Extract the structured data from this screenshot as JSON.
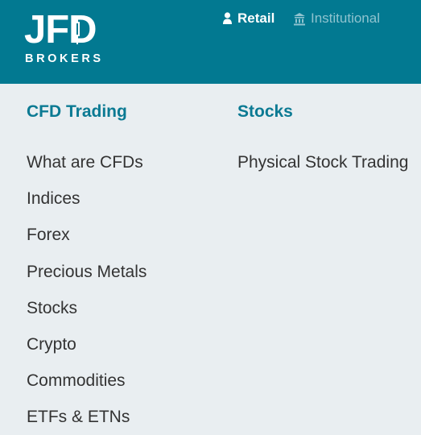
{
  "brand": {
    "logo_text": "JFD",
    "logo_subtext": "BROKERS",
    "primary_color": "#027991",
    "heading_color": "#0b7a93",
    "background_color": "#e9eef1"
  },
  "segments": {
    "retail": {
      "label": "Retail",
      "icon": "user-icon",
      "active": true
    },
    "institutional": {
      "label": "Institutional",
      "icon": "building-icon",
      "active": false
    }
  },
  "menu": {
    "cfd_trading": {
      "title": "CFD Trading",
      "items": [
        "What are CFDs",
        "Indices",
        "Forex",
        "Precious Metals",
        "Stocks",
        "Crypto",
        "Commodities",
        "ETFs & ETNs"
      ]
    },
    "stocks": {
      "title": "Stocks",
      "items": [
        "Physical Stock Trading"
      ]
    }
  }
}
